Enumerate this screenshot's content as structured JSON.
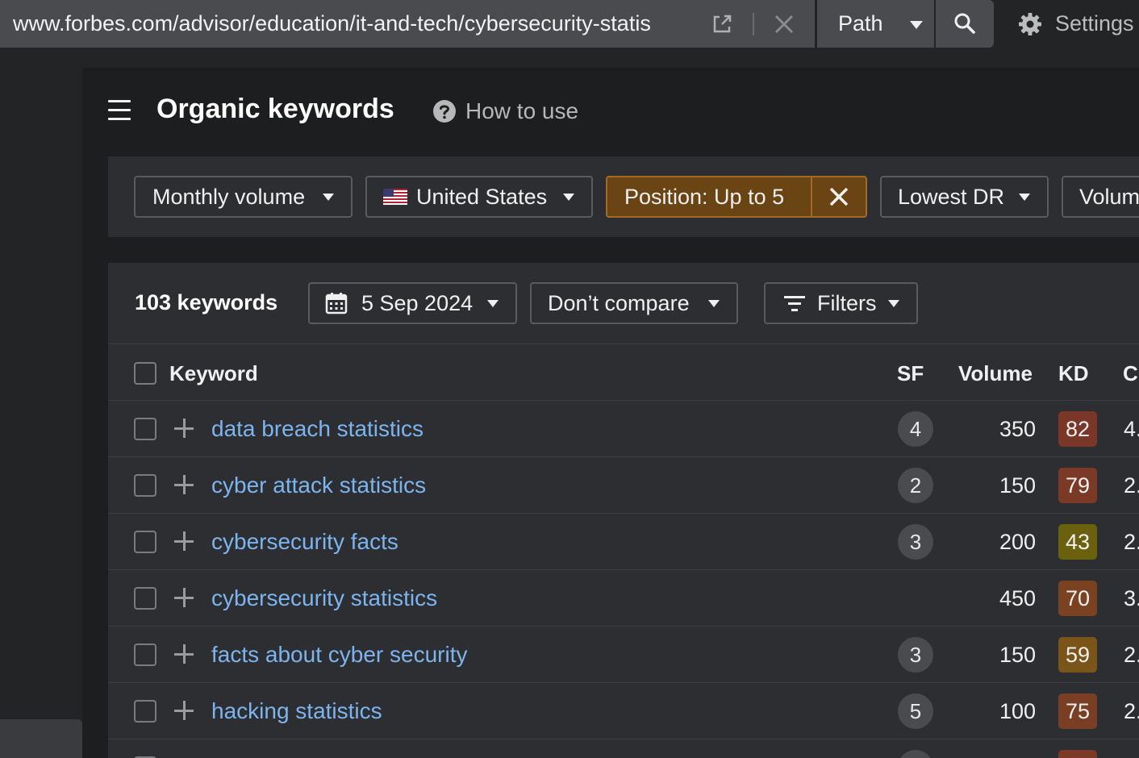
{
  "url_bar": {
    "url": "www.forbes.com/advisor/education/it-and-tech/cybersecurity-statis",
    "mode_label": "Path",
    "settings_label": "Settings"
  },
  "header": {
    "title": "Organic keywords",
    "help_label": "How to use"
  },
  "filters": {
    "volume": "Monthly volume",
    "country": "United States",
    "position": "Position: Up to 5",
    "dr": "Lowest DR",
    "volume_more": "Volum"
  },
  "toolbar": {
    "count": "103 keywords",
    "date": "5 Sep 2024",
    "compare": "Don’t compare",
    "filters": "Filters"
  },
  "table": {
    "columns": {
      "keyword": "Keyword",
      "sf": "SF",
      "volume": "Volume",
      "kd": "KD",
      "cpc": "C"
    },
    "rows": [
      {
        "keyword": "data breach statistics",
        "sf": "4",
        "volume": "350",
        "kd": "82",
        "kd_color": "#7a3626",
        "cpc": "4."
      },
      {
        "keyword": "cyber attack statistics",
        "sf": "2",
        "volume": "150",
        "kd": "79",
        "kd_color": "#7a3a26",
        "cpc": "2."
      },
      {
        "keyword": "cybersecurity facts",
        "sf": "3",
        "volume": "200",
        "kd": "43",
        "kd_color": "#6b600e",
        "cpc": "2."
      },
      {
        "keyword": "cybersecurity statistics",
        "sf": "",
        "volume": "450",
        "kd": "70",
        "kd_color": "#7a4220",
        "cpc": "3."
      },
      {
        "keyword": "facts about cyber security",
        "sf": "3",
        "volume": "150",
        "kd": "59",
        "kd_color": "#7a5418",
        "cpc": "2."
      },
      {
        "keyword": "hacking statistics",
        "sf": "5",
        "volume": "100",
        "kd": "75",
        "kd_color": "#7a3e24",
        "cpc": "2."
      }
    ]
  },
  "colors": {
    "active_filter": "#6b4413",
    "link": "#7cb4ee"
  }
}
